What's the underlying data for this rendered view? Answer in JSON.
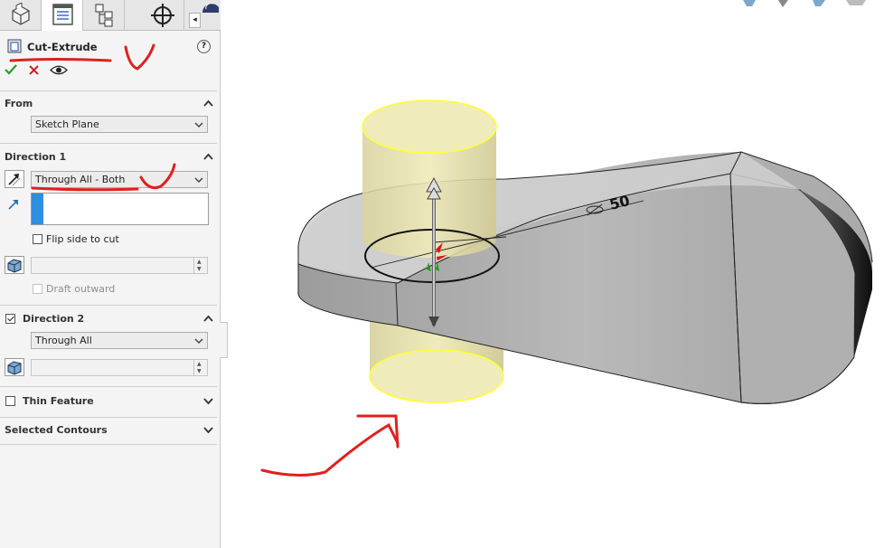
{
  "property_manager": {
    "tabs": [
      {
        "name": "feature-manager-tab",
        "icon": "part-icon"
      },
      {
        "name": "property-manager-tab",
        "icon": "property-list-icon"
      },
      {
        "name": "configuration-manager-tab",
        "icon": "configuration-tree-icon"
      },
      {
        "name": "dimxpert-tab",
        "icon": "crosshair-icon"
      }
    ],
    "feature_title": "Cut-Extrude",
    "help_label": "?",
    "sections": {
      "from": {
        "title": "From",
        "value": "Sketch Plane"
      },
      "direction1": {
        "title": "Direction 1",
        "end_condition": "Through All - Both",
        "flip_label": "Flip side to cut",
        "flip_checked": false,
        "draft_label": "Draft outward",
        "draft_checked": false
      },
      "direction2": {
        "title": "Direction 2",
        "checked": true,
        "end_condition": "Through All"
      },
      "thin_feature": {
        "title": "Thin Feature",
        "checked": false
      },
      "selected_contours": {
        "title": "Selected Contours"
      }
    }
  },
  "viewport": {
    "dimension_label": "50",
    "highlight_color": "#ffff33",
    "cut_preview_color": "#e9e3a6"
  },
  "colors": {
    "accent_blue": "#2d8fe0",
    "annotation_red": "#e0201f",
    "accept_green": "#2e9a2e"
  }
}
